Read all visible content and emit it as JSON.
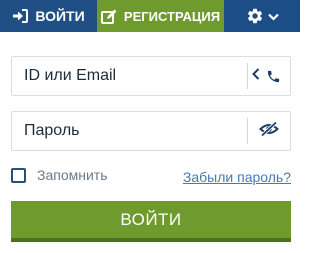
{
  "nav": {
    "login_label": "ВОЙТИ",
    "login_icon": "sign-in-icon",
    "register_label": "РЕГИСТРАЦИЯ",
    "register_icon": "edit-icon",
    "settings_icon": "gear-icon",
    "settings_chevron": "chevron-down-icon"
  },
  "form": {
    "id_placeholder": "ID или Email",
    "id_value": "",
    "password_placeholder": "Пароль",
    "password_value": "",
    "remember_label": "Запомнить",
    "remember_checked": false,
    "forgot_label": "Забыли пароль?",
    "submit_label": "ВОЙТИ"
  },
  "colors": {
    "nav_login_bg": "#1f4f84",
    "nav_register_bg": "#6f9a2e",
    "nav_settings_bg": "#1b4d86",
    "accent_green": "#6f9a2e",
    "link_blue": "#4a78b5",
    "icon_dark": "#1d3f6b"
  }
}
